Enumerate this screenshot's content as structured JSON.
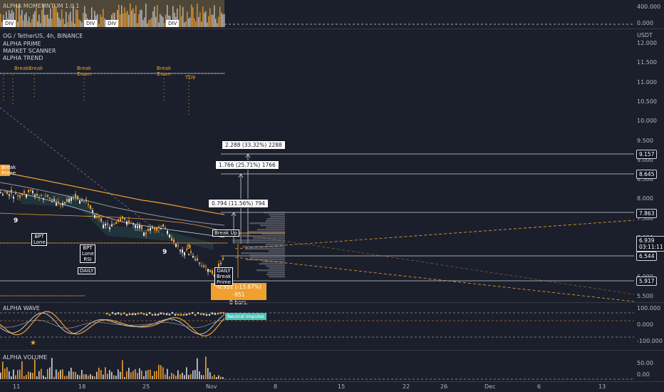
{
  "top_indicator": {
    "title": "ALPHA MOMEMNTUM 1.0.1",
    "div_labels": [
      "DIV",
      "DIV",
      "DIV",
      "DIV"
    ],
    "axis": [
      "400.000",
      "0.000"
    ]
  },
  "main": {
    "symbol_line": "OG / TetherUS, 4h, BINANCE",
    "indicators": [
      "ALPHA PRIME",
      "MARKET SCANNER",
      "ALPHA TREND"
    ],
    "currency": "USDT",
    "price_axis": [
      "12.000",
      "11.500",
      "11.000",
      "10.500",
      "10.000",
      "9.500",
      "9.000",
      "8.500",
      "8.000",
      "7.500",
      "7.000",
      "6.500",
      "6.000",
      "5.500"
    ],
    "price_tags": {
      "t1": "9.157",
      "t2": "8.645",
      "t3": "7.863",
      "current": "6.939",
      "countdown": "03:11:11",
      "t4": "6.544",
      "t5": "5.917"
    },
    "targets": {
      "tp3": "2.288 (33.32%) 2288",
      "tp2": "1.766 (25.71%) 1766",
      "tp1": "0.794 (11.56%) 794",
      "stop": "-0.951 (-13.87%) -951",
      "stop_sub": "0 bars."
    },
    "labels": {
      "break": "Break",
      "break_down": "Break Down",
      "break_prime": "Break Prime",
      "break_up": "Break Up",
      "daily_break_prime": "DAILY Break Prime",
      "bpt_lone": "BPT Lone",
      "bpt_lone_rsi": "BPT Lone RSI",
      "daily": "DAILY",
      "td9": "TD9",
      "nine": "9"
    }
  },
  "wave": {
    "title": "ALPHA WAVE",
    "axis": [
      "100.000",
      "0.000",
      "-100.000"
    ],
    "tag": "Neutral Impulse"
  },
  "volume": {
    "title": "ALPHA VOLUME",
    "axis": [
      "50.00",
      "0.00"
    ]
  },
  "time_axis": [
    "11",
    "18",
    "25",
    "Nov",
    "8",
    "15",
    "22",
    "26",
    "Dec",
    "6",
    "13"
  ],
  "colors": {
    "background": "#1b1f2b",
    "orange": "#f0a030",
    "teal": "#4fc3b8",
    "gray": "#9598a1"
  }
}
